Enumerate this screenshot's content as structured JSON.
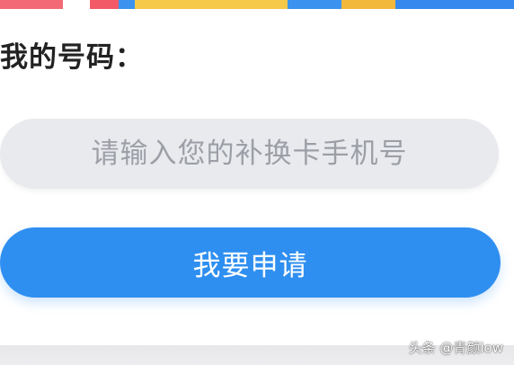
{
  "form": {
    "label": "我的号码：",
    "phone_placeholder": "请输入您的补换卡手机号",
    "phone_value": "",
    "apply_label": "我要申请"
  },
  "watermark": "头条 @青颜low",
  "colors": {
    "accent": "#2f8ff0",
    "input_background": "#e9eaee",
    "placeholder_text": "#9c9fa6"
  }
}
